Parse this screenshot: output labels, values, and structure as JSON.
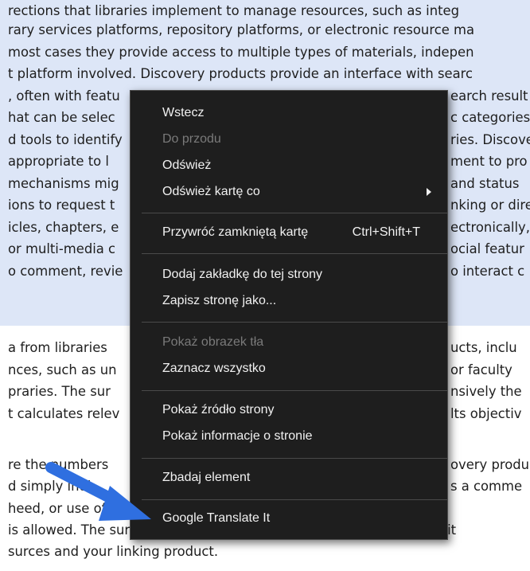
{
  "document": {
    "lines": [
      "rary services platforms, repository platforms, or electronic resource ma",
      "most cases they provide access to multiple types of materials, indepen",
      "t platform involved. Discovery products provide an interface with searc",
      ", often with featu",
      "hat can be selec",
      "d tools to identify",
      " appropriate to l",
      " mechanisms mig",
      "ions to request t",
      "icles, chapters, e",
      " or multi-media c",
      "o comment, revie",
      "a from libraries",
      "nces, such as un",
      "praries. The sur",
      "t calculates relev",
      "re the numbers",
      "d simply indi",
      "heed, or use of a",
      "is allowed. The survey should be completed by or in consultation wit"
    ],
    "right_fragments": [
      "earch result",
      "c categories",
      "ries. Discove",
      "ment to pro",
      "and status",
      "nking or dire",
      "ectronically,",
      "ocial featur",
      "o interact c",
      "ucts, inclu",
      " or faculty",
      "nsively the",
      "lts objectiv",
      "overy produ",
      "s a comme"
    ]
  },
  "context_menu": {
    "items": [
      {
        "label": "Wstecz",
        "disabled": false
      },
      {
        "label": "Do przodu",
        "disabled": true
      },
      {
        "label": "Odśwież",
        "disabled": false
      },
      {
        "label": "Odśwież kartę co",
        "disabled": false,
        "submenu": true
      },
      {
        "label": "Przywróć zamkniętą kartę",
        "shortcut": "Ctrl+Shift+T",
        "disabled": false
      },
      {
        "label": "Dodaj zakładkę do tej strony",
        "disabled": false
      },
      {
        "label": "Zapisz stronę jako...",
        "disabled": false
      },
      {
        "label": "Pokaż obrazek tła",
        "disabled": true
      },
      {
        "label": "Zaznacz wszystko",
        "disabled": false
      },
      {
        "label": "Pokaż źródło strony",
        "disabled": false
      },
      {
        "label": "Pokaż informacje o stronie",
        "disabled": false
      },
      {
        "label": "Zbadaj element",
        "disabled": false
      },
      {
        "label": "Google Translate It",
        "disabled": false
      }
    ]
  },
  "colors": {
    "selection": "#dde6f7",
    "menu_background": "#1e1e1e",
    "menu_text": "#f1f1f1",
    "menu_disabled": "#7a7a7a",
    "pointer_arrow": "#2f6fe0"
  }
}
